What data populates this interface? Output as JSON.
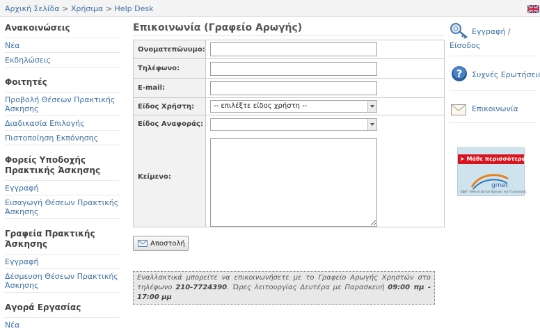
{
  "breadcrumb": {
    "home": "Αρχική Σελίδα",
    "separator": ">",
    "useful": "Χρήσιμα",
    "current": "Help Desk"
  },
  "sidebar": {
    "sections": [
      {
        "heading": "Ανακοινώσεις",
        "links": [
          "Νέα",
          "Εκδηλώσεις"
        ]
      },
      {
        "heading": "Φοιτητές",
        "links": [
          "Προβολή Θέσεων Πρακτικής Άσκησης",
          "Διαδικασία Επιλογής",
          "Πιστοποίηση Εκπόνησης"
        ]
      },
      {
        "heading": "Φορείς Υποδοχής Πρακτικής Άσκησης",
        "links": [
          "Εγγραφή",
          "Εισαγωγή Θέσεων Πρακτικής Άσκησης"
        ]
      },
      {
        "heading": "Γραφεία Πρακτικής Άσκησης",
        "links": [
          "Εγγραφή",
          "Δέσμευση Θέσεων Πρακτικής Άσκησης"
        ]
      },
      {
        "heading": "Αγορά Εργασίας",
        "links": [
          "Νέα"
        ]
      }
    ]
  },
  "main": {
    "title": "Επικοινωνία (Γραφείο Αρωγής)",
    "fields": {
      "name_label": "Ονοματεπώνυμο:",
      "phone_label": "Τηλέφωνο:",
      "email_label": "E-mail:",
      "user_type_label": "Είδος Χρήστη:",
      "user_type_value": "-- επιλέξτε είδος χρήστη --",
      "report_type_label": "Είδος Αναφοράς:",
      "report_type_value": "",
      "text_label": "Κείμενο:"
    },
    "submit_label": "Αποστολή",
    "note": {
      "text1": "Εναλλακτικά μπορείτε να επικοινωνήσετε με το Γραφείο Αρωγής Χρηστών στο τηλέφωνο ",
      "phone": "210-7724390",
      "text2": ". Ώρες λειτουργίας Δευτέρα με Παρασκευή ",
      "hours": "09:00 πμ - 17:00 μμ"
    }
  },
  "right": {
    "login_line1": "Εγγραφή /",
    "login_line2": "Είσοδος",
    "faq": "Συχνές Ερωτήσεις",
    "contact": "Επικοινωνία",
    "banner_text": "➤ Μάθε περισσότερα",
    "banner_logo": "grnet",
    "banner_footer": "ΕΔΕΤ · Εθνικό Δίκτυο Έρευνας και Τεχνολογίας"
  },
  "colors": {
    "link": "#3b6ea5",
    "banner_red": "#d8151e",
    "banner_bg": "#cfe3ee"
  }
}
